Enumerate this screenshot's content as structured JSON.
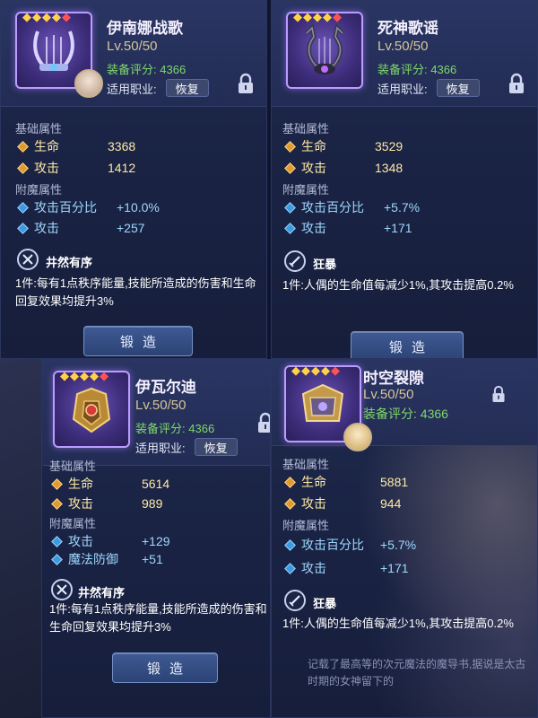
{
  "common": {
    "base_title": "基础属性",
    "ench_title": "附魔属性",
    "score_label": "装备评分:",
    "job_label": "适用职业:",
    "job_value": "恢复",
    "forge_label": "锻造",
    "stars": "◆◆◆◆",
    "star_red": "◆",
    "colors": {
      "base": "#ffe9a6",
      "ench": "#9fd8ff",
      "score": "#7fd86b",
      "frame": "#b99dff"
    }
  },
  "panels": [
    {
      "name": "伊南娜战歌",
      "level": "Lv.50/50",
      "score": "4366",
      "base": [
        {
          "name": "生命",
          "value": "3368"
        },
        {
          "name": "攻击",
          "value": "1412"
        }
      ],
      "ench": [
        {
          "name": "攻击百分比",
          "value": "+10.0%"
        },
        {
          "name": "攻击",
          "value": "+257"
        }
      ],
      "set_icon": "crossed-swords-icon",
      "set_name": "井然有序",
      "set_desc": "1件:每有1点秩序能量,技能所造成的伤害和生命回复效果均提升3%"
    },
    {
      "name": "死神歌谣",
      "level": "Lv.50/50",
      "score": "4366",
      "base": [
        {
          "name": "生命",
          "value": "3529"
        },
        {
          "name": "攻击",
          "value": "1348"
        }
      ],
      "ench": [
        {
          "name": "攻击百分比",
          "value": "+5.7%"
        },
        {
          "name": "攻击",
          "value": "+171"
        }
      ],
      "set_icon": "sword-icon",
      "set_name": "狂暴",
      "set_desc": "1件:人偶的生命值每减少1%,其攻击提高0.2%"
    },
    {
      "name": "伊瓦尔迪",
      "level": "Lv.50/50",
      "score": "4366",
      "base": [
        {
          "name": "生命",
          "value": "5614"
        },
        {
          "name": "攻击",
          "value": "989"
        }
      ],
      "ench": [
        {
          "name": "攻击",
          "value": "+129"
        },
        {
          "name": "魔法防御",
          "value": "+51"
        }
      ],
      "set_icon": "crossed-swords-icon",
      "set_name": "井然有序",
      "set_desc": "1件:每有1点秩序能量,技能所造成的伤害和生命回复效果均提升3%"
    },
    {
      "name": "时空裂隙",
      "level": "Lv.50/50",
      "score": "4366",
      "base": [
        {
          "name": "生命",
          "value": "5881"
        },
        {
          "name": "攻击",
          "value": "944"
        }
      ],
      "ench": [
        {
          "name": "攻击百分比",
          "value": "+5.7%"
        },
        {
          "name": "攻击",
          "value": "+171"
        }
      ],
      "set_icon": "sword-icon",
      "set_name": "狂暴",
      "set_desc": "1件:人偶的生命值每减少1%,其攻击提高0.2%",
      "lore": "记载了最高等的次元魔法的魔导书,据说是太古时期的女神留下的"
    }
  ]
}
